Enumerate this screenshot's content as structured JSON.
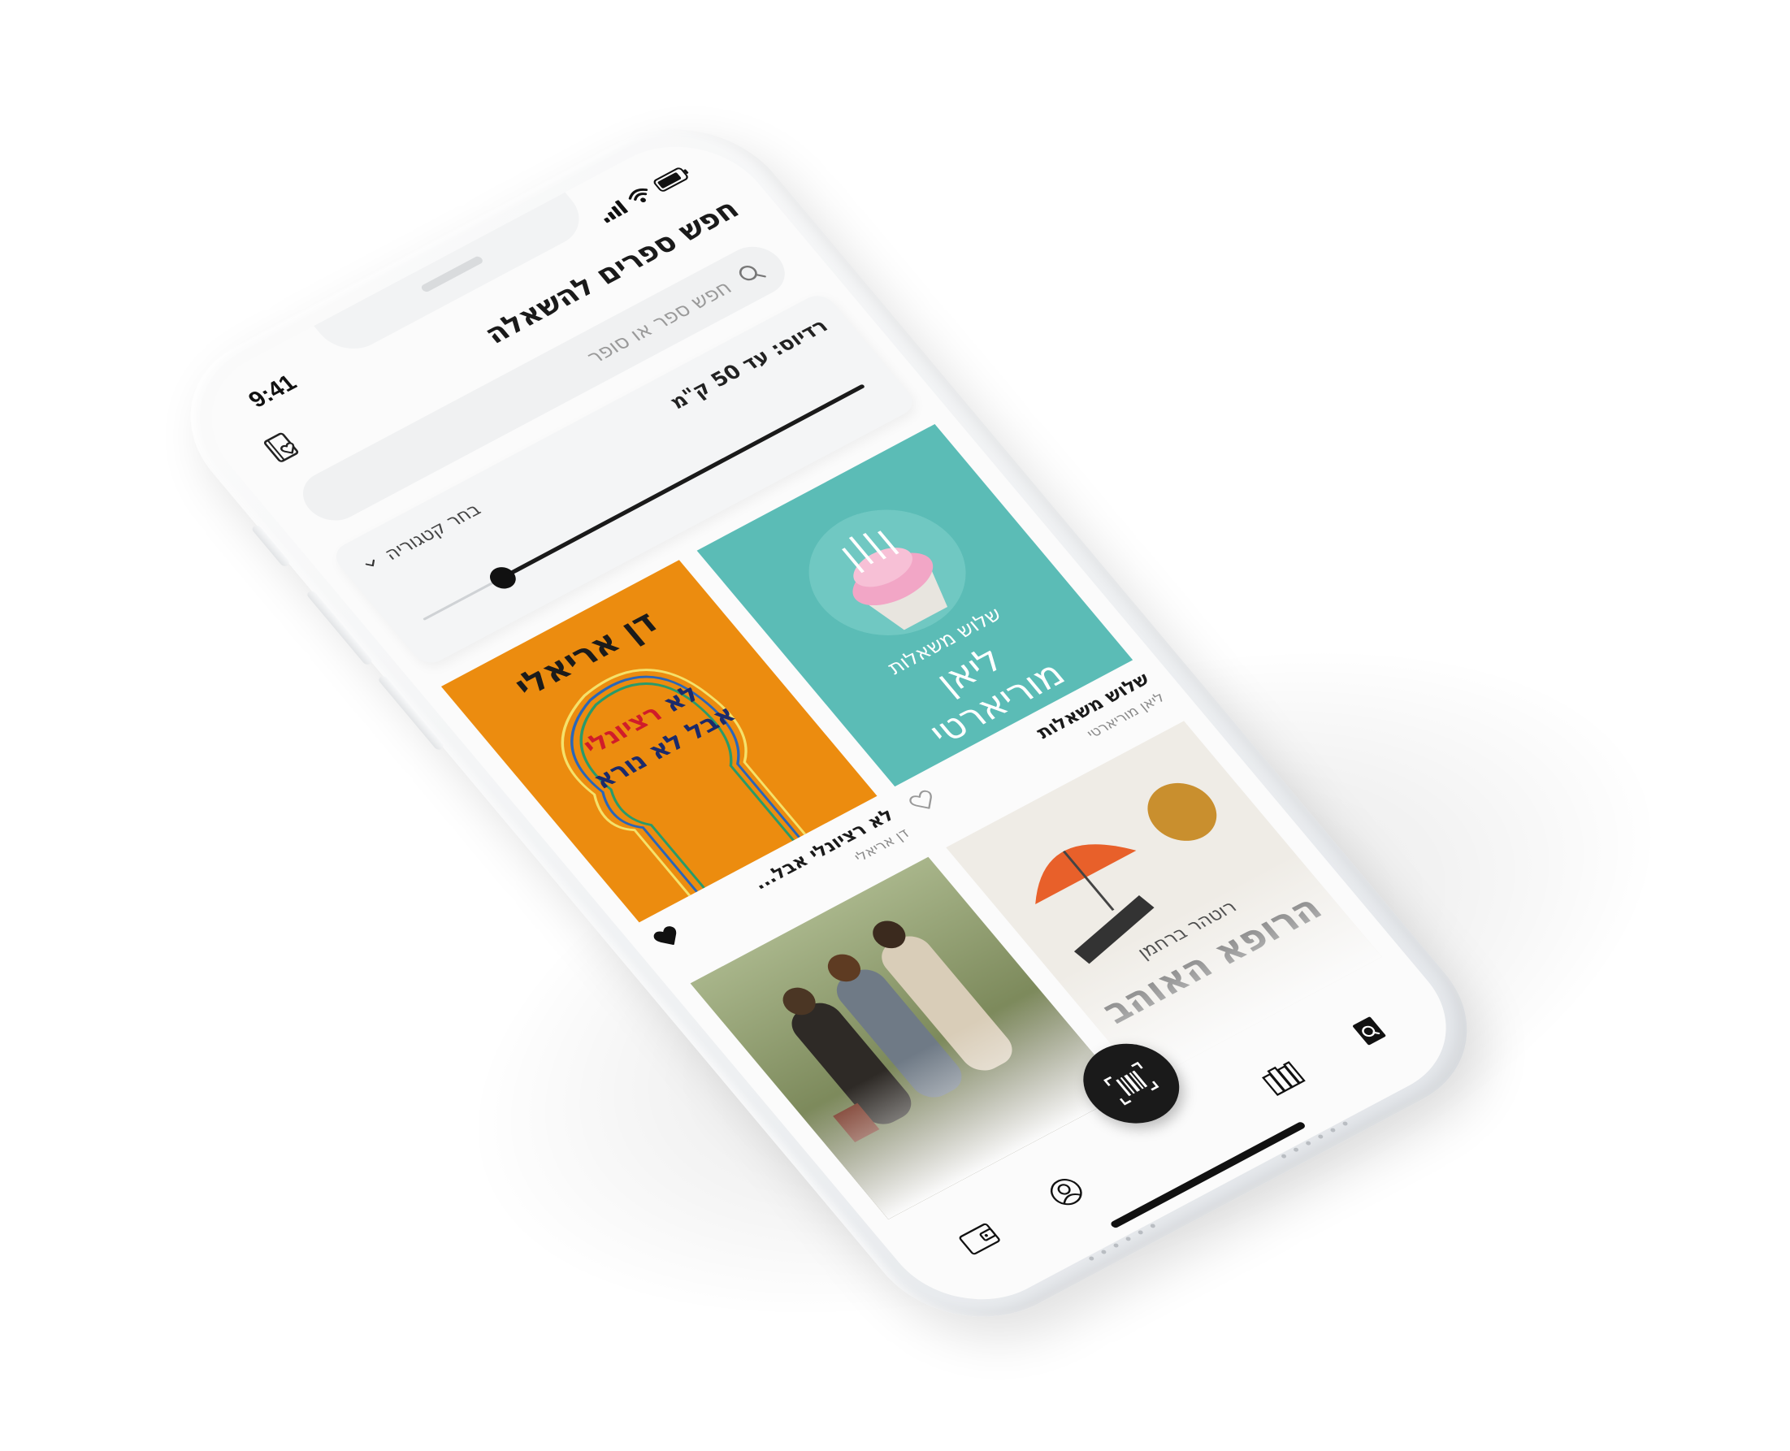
{
  "status_bar": {
    "time": "9:41"
  },
  "header": {
    "title": "חפש ספרים להשאלה",
    "wishlist_icon": "book-heart-icon"
  },
  "search": {
    "placeholder": "חפש ספר או סופר",
    "icon": "search-icon"
  },
  "filters": {
    "radius_label": "רדיוס: עד 50 ק\"מ",
    "category_label": "בחר קטגוריה",
    "radius_value_km": 50,
    "slider_fraction": 0.82
  },
  "books": [
    {
      "title": "שלוש משאלות",
      "author": "ליאן מוריארטי",
      "cover_author": "ליאן",
      "cover_author_2": "מוריארטי",
      "cover_title": "שלוש משאלות",
      "liked": false
    },
    {
      "title": "לא רציונלי אבל...",
      "author": "דן אריאלי",
      "cover_author": "דן אריאלי",
      "cover_title_red": "רציונלי",
      "cover_title_line1": "לא",
      "cover_title_line2": "אבל לא נורא",
      "liked": true
    },
    {
      "title": "",
      "author": "",
      "cover_author": "רוטהר ברחמן",
      "cover_title": "הרופא האוהב",
      "liked": false
    },
    {
      "title": "",
      "author": "",
      "liked": false
    }
  ],
  "tabbar": {
    "items": [
      "search-book-icon",
      "library-icon",
      "scan-barcode-icon",
      "profile-icon",
      "wallet-icon"
    ]
  },
  "colors": {
    "accent": "#1a1a1a",
    "cover_teal": "#5bbcb6",
    "cover_orange": "#ec8c0f",
    "background": "#fbfbfb"
  }
}
